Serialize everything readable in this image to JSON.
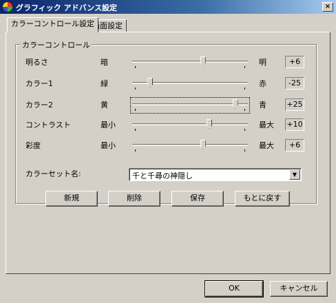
{
  "window": {
    "title": "グラフィック アドバンス設定",
    "close_label": "×"
  },
  "tabs": [
    {
      "label": "カラーコントロール設定",
      "active": true
    },
    {
      "label": "画面設定",
      "active": false
    }
  ],
  "group": {
    "label": "カラーコントロール"
  },
  "rows": [
    {
      "label": "明るさ",
      "left": "暗",
      "right": "明",
      "value": "+6",
      "level": 0.62
    },
    {
      "label": "カラー1",
      "left": "緑",
      "right": "赤",
      "value": "-25",
      "level": 0.13
    },
    {
      "label": "カラー2",
      "left": "黄",
      "right": "青",
      "value": "+25",
      "level": 0.92
    },
    {
      "label": "コントラスト",
      "left": "最小",
      "right": "最大",
      "value": "+10",
      "level": 0.68
    },
    {
      "label": "彩度",
      "left": "最小",
      "right": "最大",
      "value": "+6",
      "level": 0.62
    }
  ],
  "colorset": {
    "label": "カラーセット名:",
    "value": "千と千尋の神隠し"
  },
  "buttons": {
    "new": "新規",
    "delete": "削除",
    "save": "保存",
    "revert": "もとに戻す",
    "ok": "OK",
    "cancel": "キャンセル"
  }
}
